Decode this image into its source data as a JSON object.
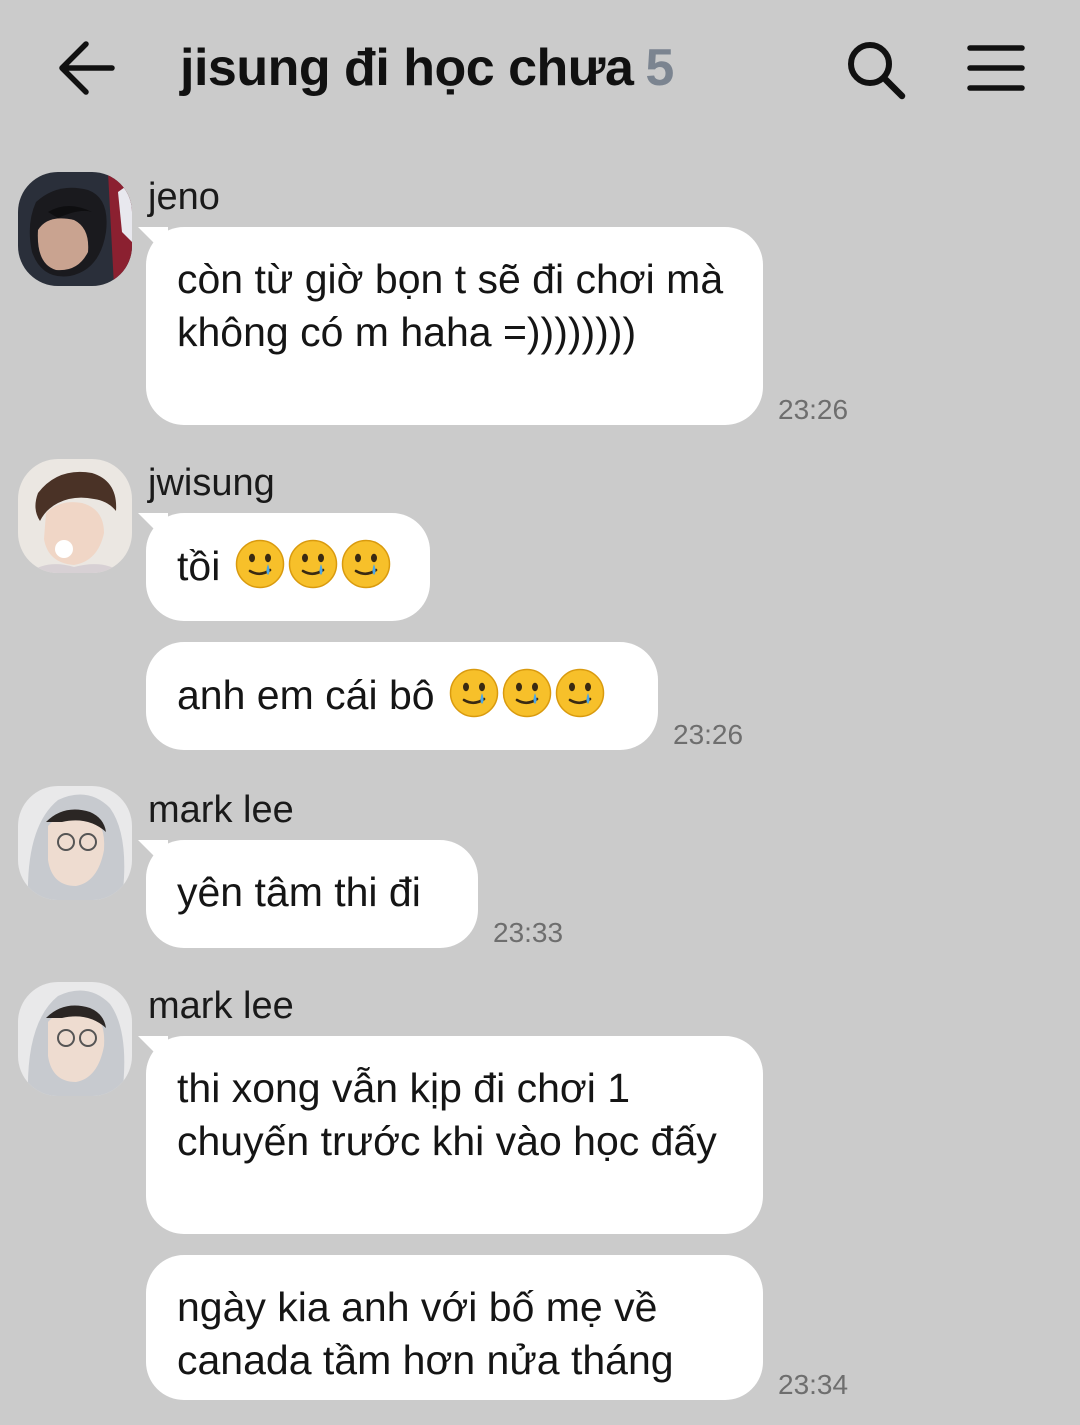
{
  "header": {
    "title": "jisung đi học chưa",
    "member_count": "5",
    "back_icon": "arrow-left-icon",
    "search_icon": "search-icon",
    "menu_icon": "hamburger-menu-icon"
  },
  "messages": [
    {
      "sender": "jeno",
      "bubbles": [
        {
          "text": "còn từ giờ bọn t sẽ đi chơi mà không có m haha =))))))))",
          "time": "23:26"
        }
      ]
    },
    {
      "sender": "jwisung",
      "bubbles": [
        {
          "text": "tồi",
          "emoji": "crying-face-emoji",
          "emoji_count": 3,
          "time": ""
        },
        {
          "text": "anh em cái bô",
          "emoji": "crying-face-emoji",
          "emoji_count": 3,
          "time": "23:26"
        }
      ]
    },
    {
      "sender": "mark lee",
      "bubbles": [
        {
          "text": "yên tâm thi đi",
          "time": "23:33"
        }
      ]
    },
    {
      "sender": "mark lee",
      "bubbles": [
        {
          "text": "thi xong vẫn kịp đi chơi 1 chuyến trước khi vào học đấy",
          "time": ""
        },
        {
          "text": "ngày kia anh với bố mẹ về canada tầm hơn nửa tháng",
          "time": "23:34"
        }
      ]
    }
  ]
}
